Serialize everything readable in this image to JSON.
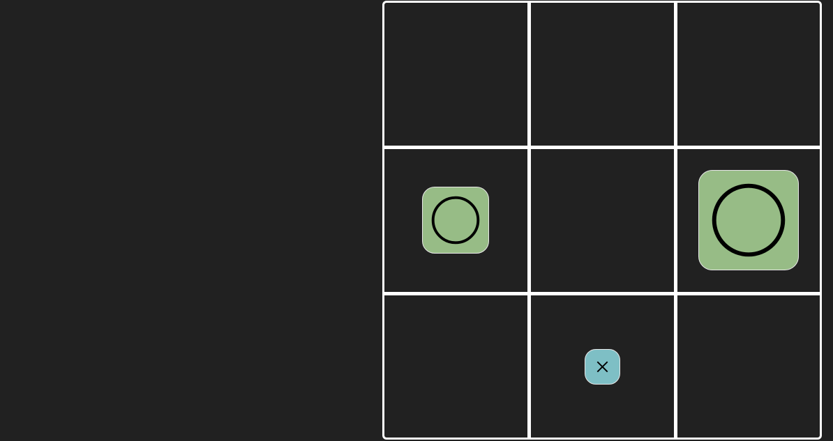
{
  "colors": {
    "background": "#212121",
    "grid": "#ffffff",
    "o_piece": "#97bc86",
    "x_piece": "#7ebfc5",
    "mark": "#000000"
  },
  "board": {
    "rows": 3,
    "cols": 3,
    "cells": [
      [
        null,
        null,
        null
      ],
      [
        {
          "mark": "O",
          "icon": "circle-icon",
          "size": "medium"
        },
        null,
        {
          "mark": "O",
          "icon": "circle-icon",
          "size": "large"
        }
      ],
      [
        null,
        {
          "mark": "X",
          "icon": "cross-icon",
          "size": "small"
        },
        null
      ]
    ]
  }
}
